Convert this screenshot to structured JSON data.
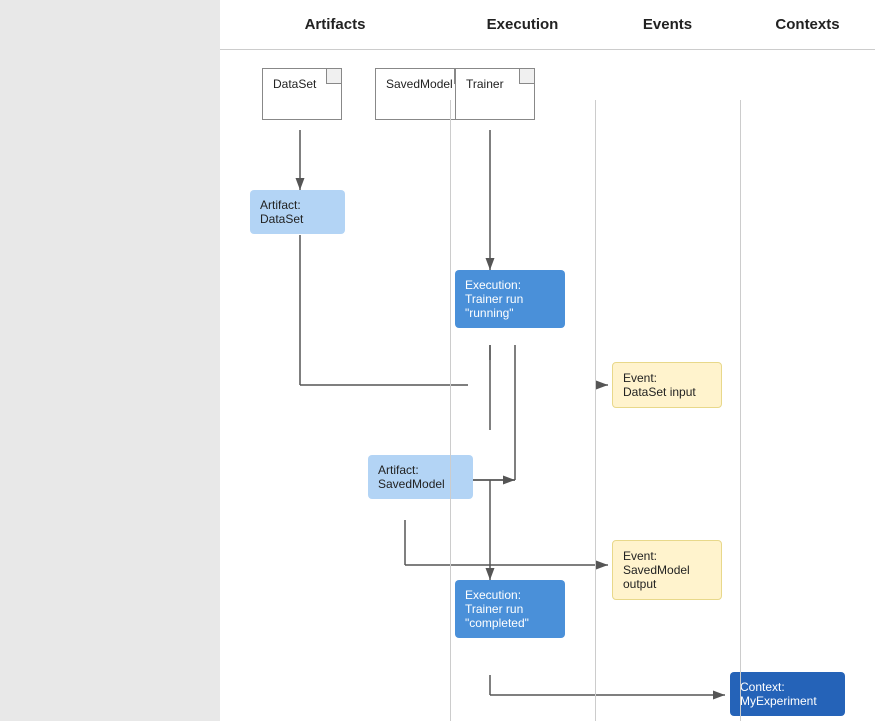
{
  "columns": {
    "artifacts": {
      "label": "Artifacts"
    },
    "execution": {
      "label": "Execution"
    },
    "events": {
      "label": "Events"
    },
    "contexts": {
      "label": "Contexts"
    }
  },
  "nodes": {
    "dataset_type": {
      "label": "DataSet"
    },
    "savedmodel_type": {
      "label": "SavedModel"
    },
    "trainer_type": {
      "label": "Trainer"
    },
    "artifact_dataset": {
      "label": "Artifact:\nDataSet",
      "line1": "Artifact:",
      "line2": "DataSet"
    },
    "execution_running": {
      "label": "Execution:\nTrainer run\n\"running\"",
      "line1": "Execution:",
      "line2": "Trainer run",
      "line3": "\"running\""
    },
    "event_dataset_input": {
      "label": "Event:\nDataSet input",
      "line1": "Event:",
      "line2": "DataSet input"
    },
    "artifact_savedmodel": {
      "label": "Artifact:\nSavedModel",
      "line1": "Artifact:",
      "line2": "SavedModel"
    },
    "event_savedmodel_output": {
      "label": "Event:\nSavedModel\noutput",
      "line1": "Event:",
      "line2": "SavedModel",
      "line3": "output"
    },
    "execution_completed": {
      "label": "Execution:\nTrainer run\n\"completed\"",
      "line1": "Execution:",
      "line2": "Trainer run",
      "line3": "\"completed\""
    },
    "context_myexperiment": {
      "label": "Context:\nMyExperiment",
      "line1": "Context:",
      "line2": "MyExperiment"
    }
  }
}
